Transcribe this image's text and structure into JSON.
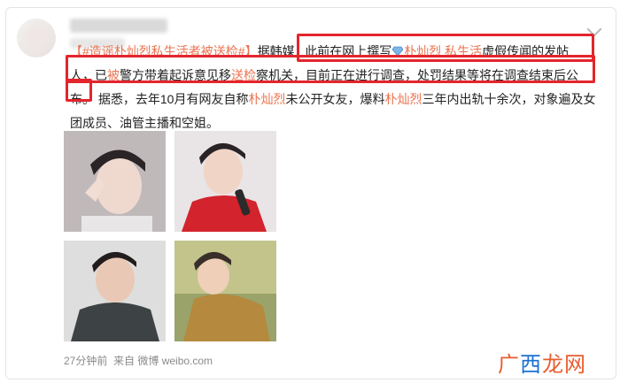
{
  "post": {
    "topic": "【#造谣朴灿烈私生活者被送检#】",
    "line1_prefix": "据韩媒",
    "line1_mid": "此前在网上撰写",
    "name_link": "朴灿烈",
    "private_link": "私生活",
    "line1_end": "虚假传闻的发帖",
    "line2_a": "人，已",
    "line2_b": "被",
    "line2_c": "警方带着起诉意见移",
    "line2_d": "送检",
    "line2_e": "察机关，目前正在进行调查，处罚结果等将在调查结束后公",
    "line3_a": "布。",
    "line3_b": "据悉，去年10月有网友自称",
    "line3_c": "朴灿烈",
    "line3_d": "未公开女友，爆料",
    "line3_e": "朴灿烈",
    "line3_f": "三年内出轨十余次，对象遍及女",
    "line4": "团成员、油管主播和空姐。"
  },
  "meta": {
    "time": "27分钟前",
    "source": "来自 微博 weibo.com"
  },
  "watermark": {
    "part1": "广",
    "part2": "西",
    "part3": "龙网"
  },
  "colors": {
    "link": "#eb7350",
    "highlight_box": "#e3252d",
    "watermark_orange": "#e85d2f",
    "watermark_blue": "#1b6fd4"
  }
}
